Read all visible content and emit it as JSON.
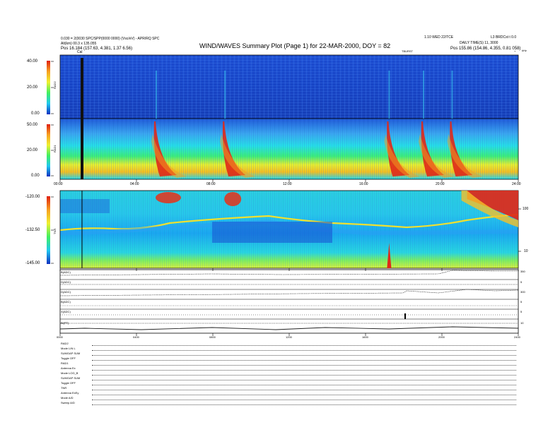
{
  "header": {
    "title": "WIND/WAVES Summary Plot (Page 1) for 22-MAR-2000, DOY = 82",
    "top_left_line1": "0.030 = 2(0030 SPC/SPP(0000 0000) (Vsc/eV) - APR/RQ SPC",
    "top_left_line2": "Alt(km) 00.3 x 135.055",
    "top_left_pos": "Pos   16.184 (157.63, 4.381, 1.37 6.56)",
    "top_right_line1": "1.10 WED 22/TCE",
    "top_right_code": "L3 BRDCst t 0.0",
    "top_right_daily": "DAILY TIME(S) 11, 3000",
    "top_right_pos": "Pos   155.86 (154.86, 4.355, 0.81 058)",
    "center_tag": "TBURST",
    "cal_label": "Cal",
    "corner_right": "kHz",
    "corner_mark": "+"
  },
  "chart_data": [
    {
      "type": "heatmap",
      "name": "RAD2",
      "ylabel": "RAD2",
      "yticks": [
        "40.00",
        "20.00",
        "0.00"
      ],
      "ylim": [
        0,
        40
      ]
    },
    {
      "type": "heatmap",
      "name": "RAD1",
      "ylabel": "RAD1",
      "yticks": [
        "50.00",
        "20.00",
        "0.00"
      ],
      "ylim": [
        0,
        50
      ]
    },
    {
      "type": "heatmap",
      "name": "TNR",
      "ylabel": "TNR",
      "yticks": [
        "-120.00",
        "-132.50",
        "-145.00"
      ],
      "ylim": [
        -145,
        -120
      ],
      "right_ticks": [
        "100",
        "10"
      ],
      "xticks": [
        "00:00",
        "04:00",
        "08:00",
        "12:00",
        "16:00",
        "20:00",
        "24:00"
      ],
      "xlim": [
        0,
        24
      ],
      "events_hours": [
        5.0,
        8.6,
        17.2,
        19.0,
        20.5
      ]
    },
    {
      "type": "line",
      "name": "housekeeping",
      "series": [
        {
          "name": "B(ADC)",
          "right": "350"
        },
        {
          "name": "D(ADC)",
          "right": "5"
        },
        {
          "name": "D(ADC)",
          "right": "300"
        },
        {
          "name": "B(ADC)",
          "right": "5"
        },
        {
          "name": "X(ADC)",
          "right": "5"
        },
        {
          "name": "Bl(PT)",
          "right": "10"
        }
      ],
      "xticks": [
        "0000",
        "0400",
        "0800",
        "1200",
        "1600",
        "2000",
        "2400"
      ]
    }
  ],
  "footer": {
    "rows": [
      "RAD2",
      "Mode   LIN L",
      "SUMGAP  SUM",
      "Toggle   OFF",
      "RAD1",
      "Antenna    Ex",
      "Mode   LOG_B",
      "SUMGAP SUM",
      "Toggle   OFF",
      "TNR",
      "Antenna  ExEy",
      "Mode    A/D",
      "Sweep    A/D"
    ]
  }
}
